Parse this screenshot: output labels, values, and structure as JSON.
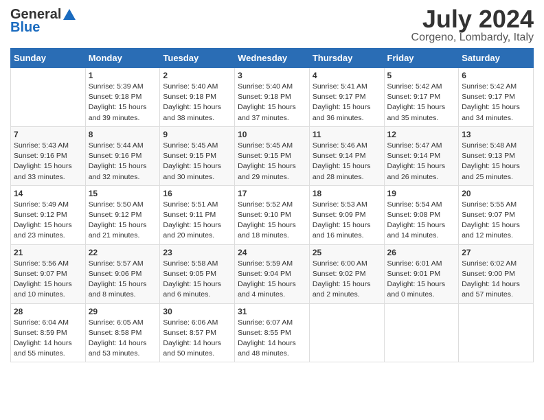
{
  "header": {
    "logo_general": "General",
    "logo_blue": "Blue",
    "title": "July 2024",
    "location": "Corgeno, Lombardy, Italy"
  },
  "calendar": {
    "days_of_week": [
      "Sunday",
      "Monday",
      "Tuesday",
      "Wednesday",
      "Thursday",
      "Friday",
      "Saturday"
    ],
    "weeks": [
      [
        {
          "day": "",
          "sunrise": "",
          "sunset": "",
          "daylight": ""
        },
        {
          "day": "1",
          "sunrise": "Sunrise: 5:39 AM",
          "sunset": "Sunset: 9:18 PM",
          "daylight": "Daylight: 15 hours and 39 minutes."
        },
        {
          "day": "2",
          "sunrise": "Sunrise: 5:40 AM",
          "sunset": "Sunset: 9:18 PM",
          "daylight": "Daylight: 15 hours and 38 minutes."
        },
        {
          "day": "3",
          "sunrise": "Sunrise: 5:40 AM",
          "sunset": "Sunset: 9:18 PM",
          "daylight": "Daylight: 15 hours and 37 minutes."
        },
        {
          "day": "4",
          "sunrise": "Sunrise: 5:41 AM",
          "sunset": "Sunset: 9:17 PM",
          "daylight": "Daylight: 15 hours and 36 minutes."
        },
        {
          "day": "5",
          "sunrise": "Sunrise: 5:42 AM",
          "sunset": "Sunset: 9:17 PM",
          "daylight": "Daylight: 15 hours and 35 minutes."
        },
        {
          "day": "6",
          "sunrise": "Sunrise: 5:42 AM",
          "sunset": "Sunset: 9:17 PM",
          "daylight": "Daylight: 15 hours and 34 minutes."
        }
      ],
      [
        {
          "day": "7",
          "sunrise": "Sunrise: 5:43 AM",
          "sunset": "Sunset: 9:16 PM",
          "daylight": "Daylight: 15 hours and 33 minutes."
        },
        {
          "day": "8",
          "sunrise": "Sunrise: 5:44 AM",
          "sunset": "Sunset: 9:16 PM",
          "daylight": "Daylight: 15 hours and 32 minutes."
        },
        {
          "day": "9",
          "sunrise": "Sunrise: 5:45 AM",
          "sunset": "Sunset: 9:15 PM",
          "daylight": "Daylight: 15 hours and 30 minutes."
        },
        {
          "day": "10",
          "sunrise": "Sunrise: 5:45 AM",
          "sunset": "Sunset: 9:15 PM",
          "daylight": "Daylight: 15 hours and 29 minutes."
        },
        {
          "day": "11",
          "sunrise": "Sunrise: 5:46 AM",
          "sunset": "Sunset: 9:14 PM",
          "daylight": "Daylight: 15 hours and 28 minutes."
        },
        {
          "day": "12",
          "sunrise": "Sunrise: 5:47 AM",
          "sunset": "Sunset: 9:14 PM",
          "daylight": "Daylight: 15 hours and 26 minutes."
        },
        {
          "day": "13",
          "sunrise": "Sunrise: 5:48 AM",
          "sunset": "Sunset: 9:13 PM",
          "daylight": "Daylight: 15 hours and 25 minutes."
        }
      ],
      [
        {
          "day": "14",
          "sunrise": "Sunrise: 5:49 AM",
          "sunset": "Sunset: 9:12 PM",
          "daylight": "Daylight: 15 hours and 23 minutes."
        },
        {
          "day": "15",
          "sunrise": "Sunrise: 5:50 AM",
          "sunset": "Sunset: 9:12 PM",
          "daylight": "Daylight: 15 hours and 21 minutes."
        },
        {
          "day": "16",
          "sunrise": "Sunrise: 5:51 AM",
          "sunset": "Sunset: 9:11 PM",
          "daylight": "Daylight: 15 hours and 20 minutes."
        },
        {
          "day": "17",
          "sunrise": "Sunrise: 5:52 AM",
          "sunset": "Sunset: 9:10 PM",
          "daylight": "Daylight: 15 hours and 18 minutes."
        },
        {
          "day": "18",
          "sunrise": "Sunrise: 5:53 AM",
          "sunset": "Sunset: 9:09 PM",
          "daylight": "Daylight: 15 hours and 16 minutes."
        },
        {
          "day": "19",
          "sunrise": "Sunrise: 5:54 AM",
          "sunset": "Sunset: 9:08 PM",
          "daylight": "Daylight: 15 hours and 14 minutes."
        },
        {
          "day": "20",
          "sunrise": "Sunrise: 5:55 AM",
          "sunset": "Sunset: 9:07 PM",
          "daylight": "Daylight: 15 hours and 12 minutes."
        }
      ],
      [
        {
          "day": "21",
          "sunrise": "Sunrise: 5:56 AM",
          "sunset": "Sunset: 9:07 PM",
          "daylight": "Daylight: 15 hours and 10 minutes."
        },
        {
          "day": "22",
          "sunrise": "Sunrise: 5:57 AM",
          "sunset": "Sunset: 9:06 PM",
          "daylight": "Daylight: 15 hours and 8 minutes."
        },
        {
          "day": "23",
          "sunrise": "Sunrise: 5:58 AM",
          "sunset": "Sunset: 9:05 PM",
          "daylight": "Daylight: 15 hours and 6 minutes."
        },
        {
          "day": "24",
          "sunrise": "Sunrise: 5:59 AM",
          "sunset": "Sunset: 9:04 PM",
          "daylight": "Daylight: 15 hours and 4 minutes."
        },
        {
          "day": "25",
          "sunrise": "Sunrise: 6:00 AM",
          "sunset": "Sunset: 9:02 PM",
          "daylight": "Daylight: 15 hours and 2 minutes."
        },
        {
          "day": "26",
          "sunrise": "Sunrise: 6:01 AM",
          "sunset": "Sunset: 9:01 PM",
          "daylight": "Daylight: 15 hours and 0 minutes."
        },
        {
          "day": "27",
          "sunrise": "Sunrise: 6:02 AM",
          "sunset": "Sunset: 9:00 PM",
          "daylight": "Daylight: 14 hours and 57 minutes."
        }
      ],
      [
        {
          "day": "28",
          "sunrise": "Sunrise: 6:04 AM",
          "sunset": "Sunset: 8:59 PM",
          "daylight": "Daylight: 14 hours and 55 minutes."
        },
        {
          "day": "29",
          "sunrise": "Sunrise: 6:05 AM",
          "sunset": "Sunset: 8:58 PM",
          "daylight": "Daylight: 14 hours and 53 minutes."
        },
        {
          "day": "30",
          "sunrise": "Sunrise: 6:06 AM",
          "sunset": "Sunset: 8:57 PM",
          "daylight": "Daylight: 14 hours and 50 minutes."
        },
        {
          "day": "31",
          "sunrise": "Sunrise: 6:07 AM",
          "sunset": "Sunset: 8:55 PM",
          "daylight": "Daylight: 14 hours and 48 minutes."
        },
        {
          "day": "",
          "sunrise": "",
          "sunset": "",
          "daylight": ""
        },
        {
          "day": "",
          "sunrise": "",
          "sunset": "",
          "daylight": ""
        },
        {
          "day": "",
          "sunrise": "",
          "sunset": "",
          "daylight": ""
        }
      ]
    ]
  }
}
